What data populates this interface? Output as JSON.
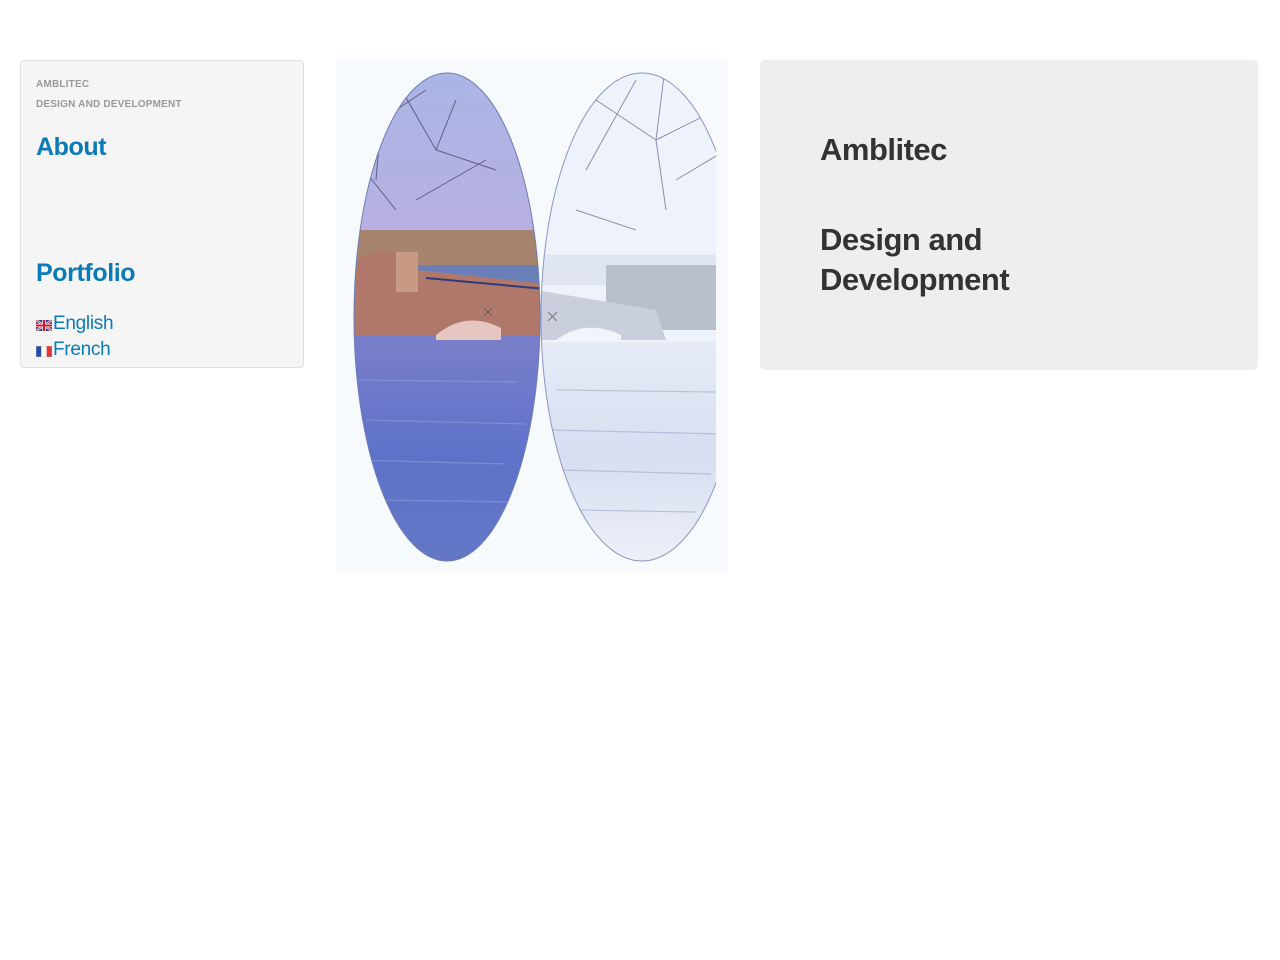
{
  "sidebar": {
    "brand_name": "AMBLITEC",
    "brand_tagline": "DESIGN AND DEVELOPMENT",
    "nav": {
      "about": "About",
      "portfolio": "Portfolio"
    },
    "languages": [
      {
        "label": "English",
        "flag": "uk-flag-icon"
      },
      {
        "label": "French",
        "flag": "france-flag-icon"
      }
    ]
  },
  "panel": {
    "title": "Amblitec",
    "subtitle": "Design and Development"
  },
  "colors": {
    "link": "#0b7ab8",
    "heading": "#333333",
    "sidebar_bg": "#f5f5f5",
    "panel_bg": "#eeeeee"
  }
}
